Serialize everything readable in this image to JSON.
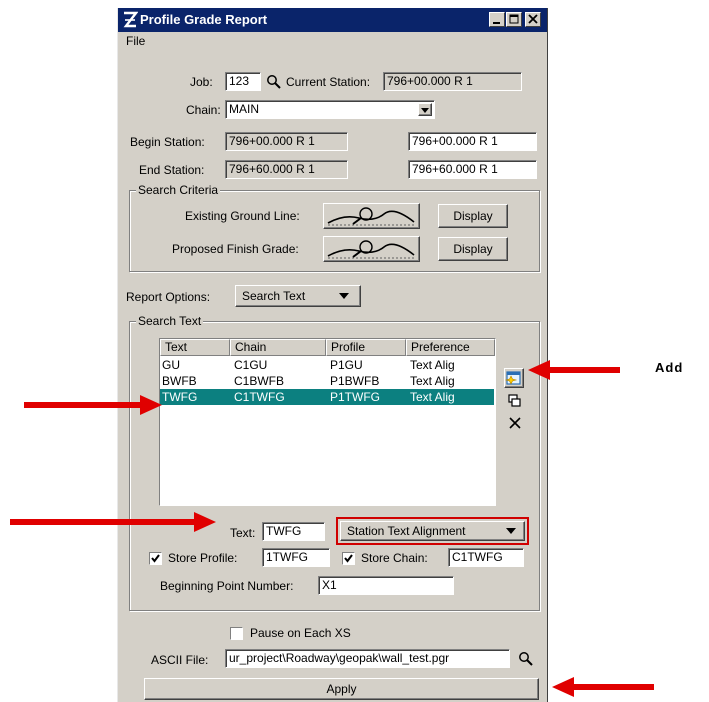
{
  "window": {
    "title": "Profile Grade Report"
  },
  "menu": {
    "file": "File"
  },
  "job": {
    "label": "Job:",
    "value": "123"
  },
  "current_station": {
    "label": "Current Station:",
    "value": "796+00.000 R 1"
  },
  "chain": {
    "label": "Chain:",
    "value": "MAIN"
  },
  "begin_station": {
    "label": "Begin Station:",
    "value": "796+00.000 R 1",
    "input": "796+00.000 R 1"
  },
  "end_station": {
    "label": "End Station:",
    "value": "796+60.000 R 1",
    "input": "796+60.000 R 1"
  },
  "search_criteria": {
    "title": "Search Criteria",
    "existing_label": "Existing Ground Line:",
    "proposed_label": "Proposed Finish Grade:",
    "display_label": "Display"
  },
  "report_options": {
    "label": "Report Options:",
    "value": "Search Text"
  },
  "search_text": {
    "title": "Search Text",
    "columns": [
      "Text",
      "Chain",
      "Profile",
      "Preference"
    ],
    "rows": [
      [
        "GU",
        "C1GU",
        "P1GU",
        "Text Alig"
      ],
      [
        "BWFB",
        "C1BWFB",
        "P1BWFB",
        "Text Alig"
      ],
      [
        "TWFG",
        "C1TWFG",
        "P1TWFG",
        "Text Alig"
      ]
    ],
    "selected_row": 2,
    "text_label": "Text:",
    "text_value": "TWFG",
    "alignment_value": "Station Text Alignment",
    "store_profile_label": "Store Profile:",
    "store_profile_value": "1TWFG",
    "store_profile_checked": true,
    "store_chain_label": "Store Chain:",
    "store_chain_value": "C1TWFG",
    "store_chain_checked": true,
    "beginning_point_label": "Beginning Point Number:",
    "beginning_point_value": "X1"
  },
  "pause": {
    "label": "Pause on Each XS",
    "checked": false
  },
  "ascii_file": {
    "label": "ASCII File:",
    "value": "ur_project\\Roadway\\geopak\\wall_test.pgr"
  },
  "apply": {
    "label": "Apply"
  },
  "annotation": {
    "add_label": "Add"
  },
  "colors": {
    "titlebar": "#0a246a",
    "selection": "#0c8080",
    "arrow": "#e00000",
    "highlight_border": "#d00000"
  }
}
